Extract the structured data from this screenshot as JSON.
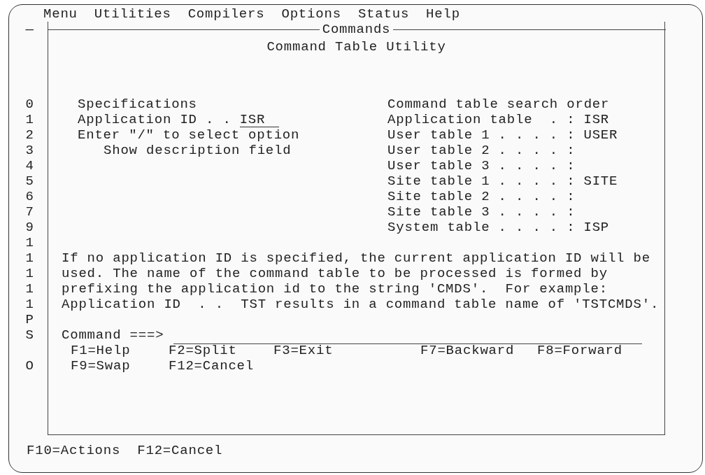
{
  "menu_bar": [
    "Menu",
    "Utilities",
    "Compilers",
    "Options",
    "Status",
    "Help"
  ],
  "edge_mark": "—",
  "screen_edge_chars": [
    [
      "0",
      "1",
      "2",
      "3",
      "4",
      "5",
      "6",
      "7",
      "9",
      "1",
      "1",
      "1",
      "1",
      "1",
      "P",
      "S"
    ],
    [
      "O"
    ]
  ],
  "popup": {
    "title": "Commands",
    "heading": "Command Table Utility",
    "specifications": {
      "title": "Specifications",
      "application_id": {
        "label": "Application ID . .",
        "value": "ISR"
      },
      "option_prompt": "Enter \"/\" to select option",
      "options": [
        "Show description field"
      ]
    },
    "search_order": {
      "title": "Command table search order",
      "entries": [
        {
          "label": "Application table  . :",
          "value": "ISR"
        },
        {
          "label": "User table 1 . . . . :",
          "value": "USER"
        },
        {
          "label": "User table 2 . . . . :"
        },
        {
          "label": "User table 3 . . . . :"
        },
        {
          "label": "Site table 1 . . . . :",
          "value": "SITE"
        },
        {
          "label": "Site table 2 . . . . :"
        },
        {
          "label": "Site table 3 . . . . :"
        },
        {
          "label": "System table . . . . :",
          "value": "ISP"
        }
      ]
    },
    "help_text": "If no application ID is specified, the current application ID will be\nused. The name of the command table to be processed is formed by\nprefixing the application id to the string 'CMDS'.  For example:\nApplication ID  . .  TST results in a command table name of 'TSTCMDS'.",
    "command": {
      "label": "Command ===>"
    },
    "function_keys": [
      [
        "F1=Help",
        "F2=Split",
        "F3=Exit",
        "F7=Backward",
        "F8=Forward"
      ],
      [
        "F9=Swap",
        "F12=Cancel"
      ]
    ]
  },
  "bottom_function_keys": [
    "F10=Actions",
    "F12=Cancel"
  ]
}
